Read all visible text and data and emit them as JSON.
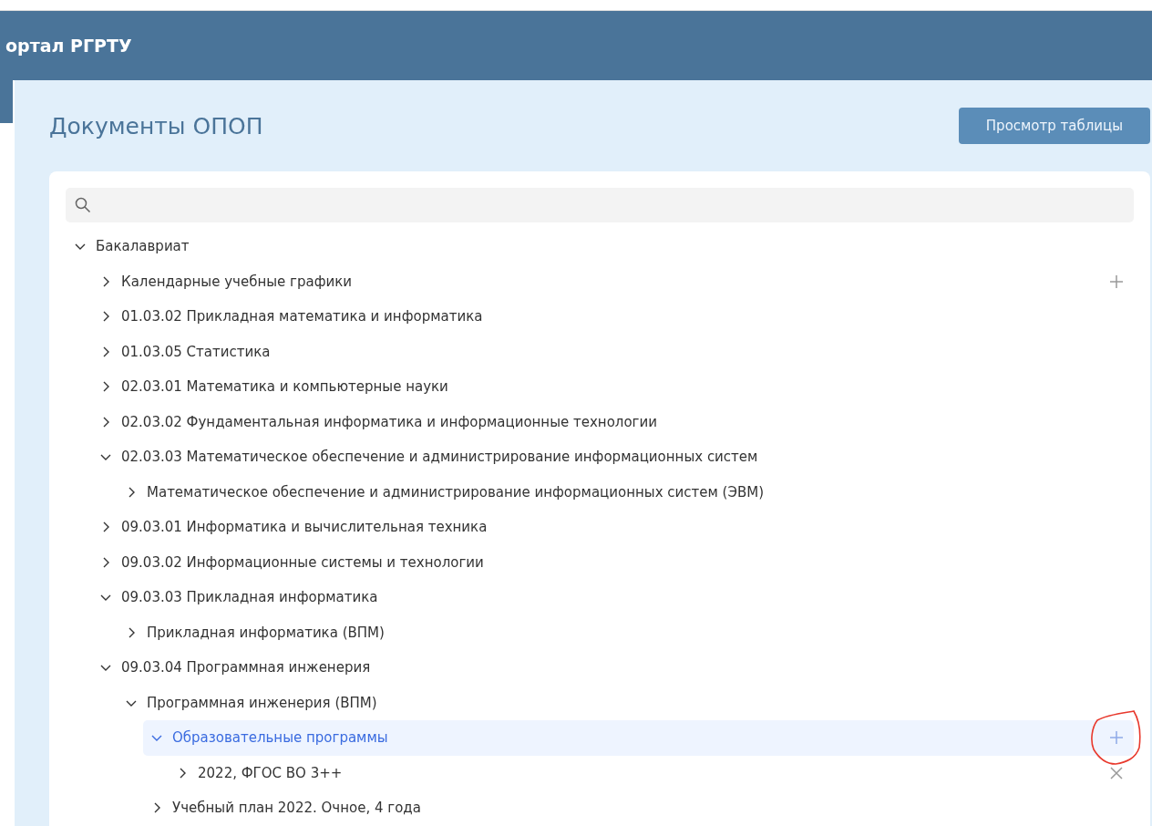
{
  "header": {
    "title": "ортал РГРТУ"
  },
  "page": {
    "title": "Документы ОПОП",
    "button": "Просмотр таблицы"
  },
  "tree": [
    {
      "label": "Бакалавриат",
      "expanded": true,
      "selected": false,
      "children": [
        {
          "label": "Календарные учебные графики",
          "expanded": false,
          "selected": false,
          "kind": "add"
        },
        {
          "label": "01.03.02 Прикладная математика и информатика",
          "expanded": false,
          "selected": false
        },
        {
          "label": "01.03.05 Статистика",
          "expanded": false,
          "selected": false
        },
        {
          "label": "02.03.01 Математика и компьютерные науки",
          "expanded": false,
          "selected": false
        },
        {
          "label": "02.03.02 Фундаментальная информатика и информационные технологии",
          "expanded": false,
          "selected": false
        },
        {
          "label": "02.03.03 Математическое обеспечение и администрирование информационных систем",
          "expanded": true,
          "selected": false,
          "children": [
            {
              "label": "Математическое обеспечение и администрирование информационных систем (ЭВМ)",
              "expanded": false,
              "selected": false
            }
          ]
        },
        {
          "label": "09.03.01 Информатика и вычислительная техника",
          "expanded": false,
          "selected": false
        },
        {
          "label": "09.03.02 Информационные системы и технологии",
          "expanded": false,
          "selected": false
        },
        {
          "label": "09.03.03 Прикладная информатика",
          "expanded": true,
          "selected": false,
          "children": [
            {
              "label": "Прикладная информатика (ВПМ)",
              "expanded": false,
              "selected": false
            }
          ]
        },
        {
          "label": "09.03.04 Программная инженерия",
          "expanded": true,
          "selected": false,
          "children": [
            {
              "label": "Программная инженерия (ВПМ)",
              "expanded": true,
              "selected": false,
              "children": [
                {
                  "label": "Образовательные программы",
                  "expanded": true,
                  "selected": true,
                  "kind": "add",
                  "annotated": true,
                  "children": [
                    {
                      "label": "2022, ФГОС ВО 3++",
                      "expanded": false,
                      "selected": false,
                      "kind": "remove"
                    }
                  ]
                },
                {
                  "label": "Учебный план 2022. Очное, 4 года",
                  "expanded": false,
                  "selected": false
                }
              ]
            }
          ]
        }
      ]
    }
  ]
}
